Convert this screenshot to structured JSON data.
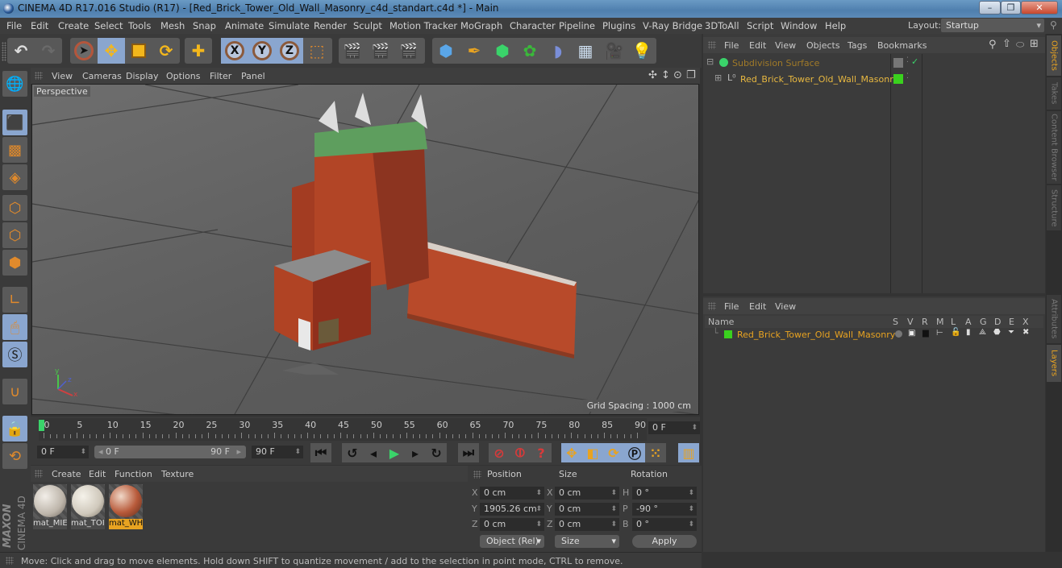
{
  "window": {
    "title": "CINEMA 4D R17.016 Studio (R17) - [Red_Brick_Tower_Old_Wall_Masonry_c4d_standart.c4d *] - Main",
    "minimize": "–",
    "restore": "❐",
    "close": "✕"
  },
  "menubar": {
    "items": [
      "File",
      "Edit",
      "Create",
      "Select",
      "Tools",
      "Mesh",
      "Snap",
      "Animate",
      "Simulate",
      "Render",
      "Sculpt",
      "Motion Tracker",
      "MoGraph",
      "Character",
      "Pipeline",
      "Plugins",
      "V-Ray Bridge",
      "3DToAll",
      "Script",
      "Window",
      "Help"
    ],
    "layout_label": "Layout:",
    "layout_value": "Startup"
  },
  "toolbar": {
    "undo": "↶",
    "redo": "↷",
    "axis_x": "X",
    "axis_y": "Y",
    "axis_z": "Z"
  },
  "viewport": {
    "menu": [
      "View",
      "Cameras",
      "Display",
      "Options",
      "Filter",
      "Panel"
    ],
    "camera_label": "Perspective",
    "grid_spacing": "Grid Spacing : 1000 cm",
    "axis_x": "x",
    "axis_y": "y",
    "axis_z": "z"
  },
  "timeline": {
    "ticks": [
      "0",
      "5",
      "10",
      "15",
      "20",
      "25",
      "30",
      "35",
      "40",
      "45",
      "50",
      "55",
      "60",
      "65",
      "70",
      "75",
      "80",
      "85",
      "90"
    ],
    "current_frame": "0 F",
    "start_field": "0 F",
    "range_start": "0 F",
    "range_end": "90 F",
    "end_field": "90 F"
  },
  "materials": {
    "menu": [
      "Create",
      "Edit",
      "Function",
      "Texture"
    ],
    "items": [
      {
        "label": "mat_MIE",
        "selected": false
      },
      {
        "label": "mat_TOI",
        "selected": false
      },
      {
        "label": "mat_WH",
        "selected": true
      }
    ]
  },
  "coordinates": {
    "headers": {
      "position": "Position",
      "size": "Size",
      "rotation": "Rotation"
    },
    "position": {
      "x": "0 cm",
      "y": "1905.26 cm",
      "z": "0 cm"
    },
    "size": {
      "x": "0 cm",
      "y": "0 cm",
      "z": "0 cm"
    },
    "rotation": {
      "h": "0 °",
      "p": "-90 °",
      "b": "0 °"
    },
    "labels": {
      "x": "X",
      "y": "Y",
      "z": "Z",
      "h": "H",
      "p": "P",
      "b": "B"
    },
    "mode_select": "Object (Rel)",
    "size_select": "Size",
    "apply_label": "Apply"
  },
  "status": {
    "text": "Move: Click and drag to move elements. Hold down SHIFT to quantize movement / add to the selection in point mode, CTRL to remove."
  },
  "objects_panel": {
    "menu": [
      "File",
      "Edit",
      "View",
      "Objects",
      "Tags",
      "Bookmarks"
    ],
    "rows": [
      {
        "name": "Subdivision Surface",
        "color": "#a07a28"
      },
      {
        "name": "Red_Brick_Tower_Old_Wall_Masonry",
        "color": "#e8b840"
      }
    ]
  },
  "layers_panel": {
    "menu": [
      "File",
      "Edit",
      "View"
    ],
    "columns": [
      "Name",
      "S",
      "V",
      "R",
      "M",
      "L",
      "A",
      "G",
      "D",
      "E",
      "X"
    ],
    "rows": [
      {
        "name": "Red_Brick_Tower_Old_Wall_Masonry",
        "color": "#3ad11e"
      }
    ]
  },
  "right_tabs": [
    "Objects",
    "Takes",
    "Content Browser",
    "Structure",
    "Attributes",
    "Layers"
  ],
  "branding": {
    "maxon": "MAXON",
    "product": "CINEMA 4D"
  },
  "colors": {
    "accent": "#e8a321",
    "selection_blue": "#8aa6cf",
    "layer_green": "#3ad11e"
  }
}
